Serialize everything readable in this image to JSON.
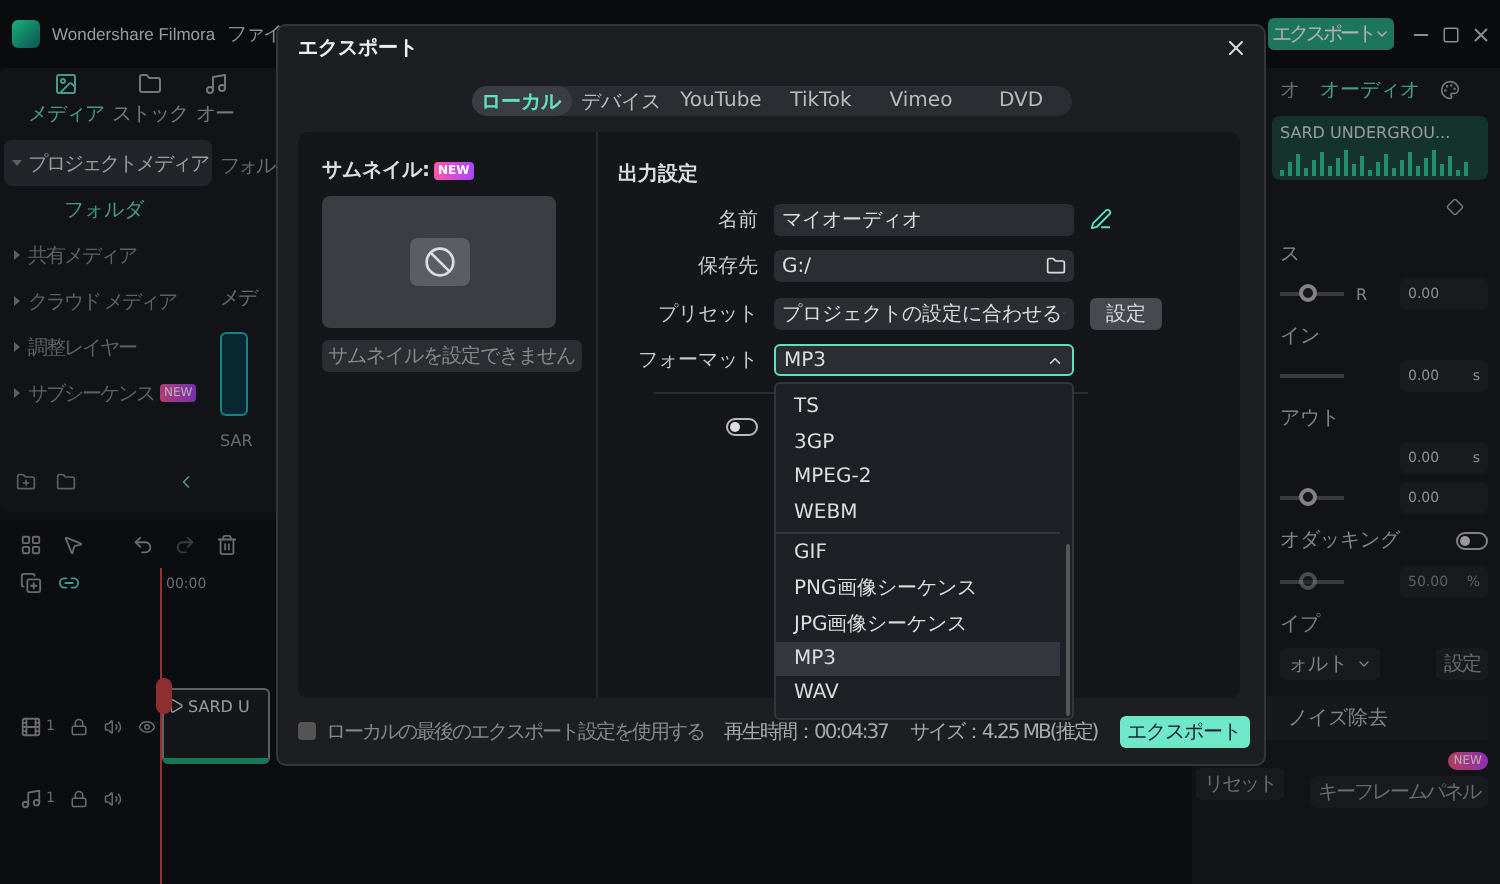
{
  "app": {
    "name": "Wondershare Filmora",
    "menu": [
      "ファイ"
    ],
    "export_button": "エクスポート"
  },
  "media_panel": {
    "tabs": [
      {
        "label": "メディア",
        "selected": true
      },
      {
        "label": "ストック",
        "selected": false
      },
      {
        "label": "オー",
        "selected": false
      }
    ],
    "sidebar": [
      {
        "label": "プロジェクトメディア",
        "selected": true,
        "expanded": true,
        "children": [
          {
            "label": "フォルダ",
            "selected": true
          }
        ]
      },
      {
        "label": "共有メディア",
        "selected": false,
        "expanded": false
      },
      {
        "label": "クラウド メディア",
        "selected": false,
        "expanded": false
      },
      {
        "label": "調整レイヤー",
        "selected": false,
        "expanded": false
      },
      {
        "label": "サブシーケンス",
        "selected": false,
        "expanded": false,
        "badge": "NEW"
      }
    ],
    "folder_label": "フォル",
    "section_label": "メデ",
    "clip_label": "SAR"
  },
  "timeline": {
    "ruler_start": "00:00",
    "clip": "SARD U",
    "tracks": [
      {
        "kind": "video",
        "number": "1"
      },
      {
        "kind": "audio",
        "number": "1"
      }
    ]
  },
  "properties": {
    "tabs": [
      {
        "label": "オ",
        "selected": false
      },
      {
        "label": "オーディオ",
        "selected": true
      }
    ],
    "clip_name": "SARD UNDERGROU...",
    "rows": [
      {
        "kind": "label",
        "text": "ス"
      },
      {
        "kind": "slider",
        "level": 0.45,
        "prefix": "R",
        "value": "0.00"
      },
      {
        "kind": "label",
        "text": "イン"
      },
      {
        "kind": "track",
        "value": "0.00",
        "unit": "s"
      },
      {
        "kind": "label",
        "text": "アウト"
      },
      {
        "kind": "field",
        "value": "0.00",
        "unit": "s"
      },
      {
        "kind": "slider",
        "level": 0.45,
        "value": "0.00"
      },
      {
        "kind": "toggle",
        "text": "オダッキング",
        "on": false
      },
      {
        "kind": "slider",
        "level": 0.45,
        "value": "50.00",
        "unit": "%",
        "disabled": true
      },
      {
        "kind": "label",
        "text": "イプ"
      },
      {
        "kind": "select",
        "value": "ォルト",
        "button": "設定"
      }
    ],
    "section": "ノイズ除去",
    "buttons": [
      {
        "label": "リセット"
      },
      {
        "label": "キーフレームパネル",
        "badge": "NEW"
      }
    ]
  },
  "export_dialog": {
    "title": "エクスポート",
    "tabs": [
      {
        "label": "ローカル",
        "selected": true
      },
      {
        "label": "デバイス",
        "selected": false
      },
      {
        "label": "YouTube",
        "selected": false
      },
      {
        "label": "TikTok",
        "selected": false
      },
      {
        "label": "Vimeo",
        "selected": false
      },
      {
        "label": "DVD",
        "selected": false
      }
    ],
    "thumbnail": {
      "label": "サムネイル:",
      "badge": "NEW",
      "button": "サムネイルを設定できません"
    },
    "settings": {
      "heading": "出力設定",
      "fields": [
        {
          "label": "名前",
          "kind": "text",
          "value": "マイオーディオ"
        },
        {
          "label": "保存先",
          "kind": "folder",
          "value": "G:/"
        },
        {
          "label": "プリセット",
          "kind": "select",
          "value": "プロジェクトの設定に合わせる",
          "button": "設定",
          "expanded": false
        },
        {
          "label": "フォーマット",
          "kind": "select",
          "value": "MP3",
          "expanded": true
        }
      ],
      "toggle_on": false
    },
    "format_groups": [
      [
        {
          "label": "TS",
          "selected": false
        },
        {
          "label": "3GP",
          "selected": false
        },
        {
          "label": "MPEG-2",
          "selected": false
        },
        {
          "label": "WEBM",
          "selected": false
        }
      ],
      [
        {
          "label": "GIF",
          "selected": false
        },
        {
          "label": "PNG画像シーケンス",
          "selected": false
        },
        {
          "label": "JPG画像シーケンス",
          "selected": false
        },
        {
          "label": "MP3",
          "selected": true
        },
        {
          "label": "WAV",
          "selected": false
        }
      ]
    ],
    "footer": {
      "checkbox": {
        "label": "ローカルの最後のエクスポート設定を使用する",
        "checked": false
      },
      "duration": "再生時間：00:04:37",
      "size": "サイズ：4.25 MB(推定)",
      "export_button": "エクスポート"
    }
  }
}
